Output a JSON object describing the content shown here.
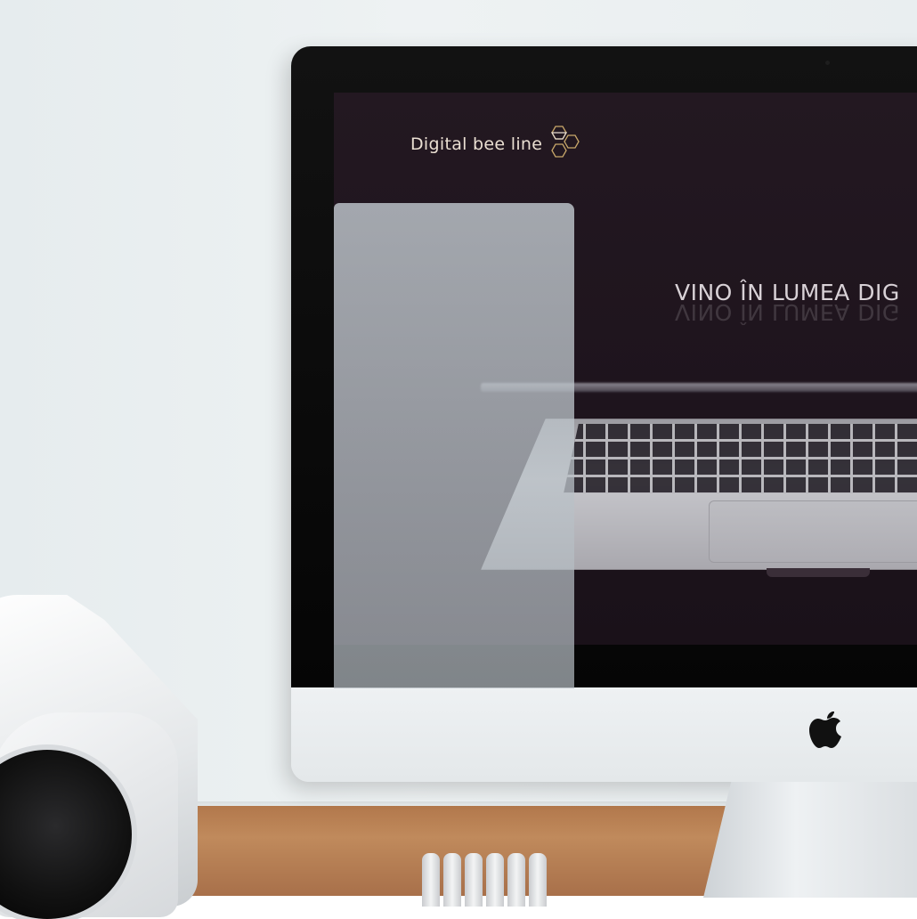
{
  "website": {
    "logo_text": "Digital bee line",
    "headline": "VINO ÎN LUMEA DIG"
  },
  "colors": {
    "screen_background": "#1e141d",
    "logo_text": "#eadfd2",
    "logo_hexagon_outline": "#c9a86a",
    "headline_text": "#d8d1d6"
  },
  "icons": {
    "logo": "hexagon-cluster-icon",
    "device_brand": "apple-logo-icon"
  }
}
